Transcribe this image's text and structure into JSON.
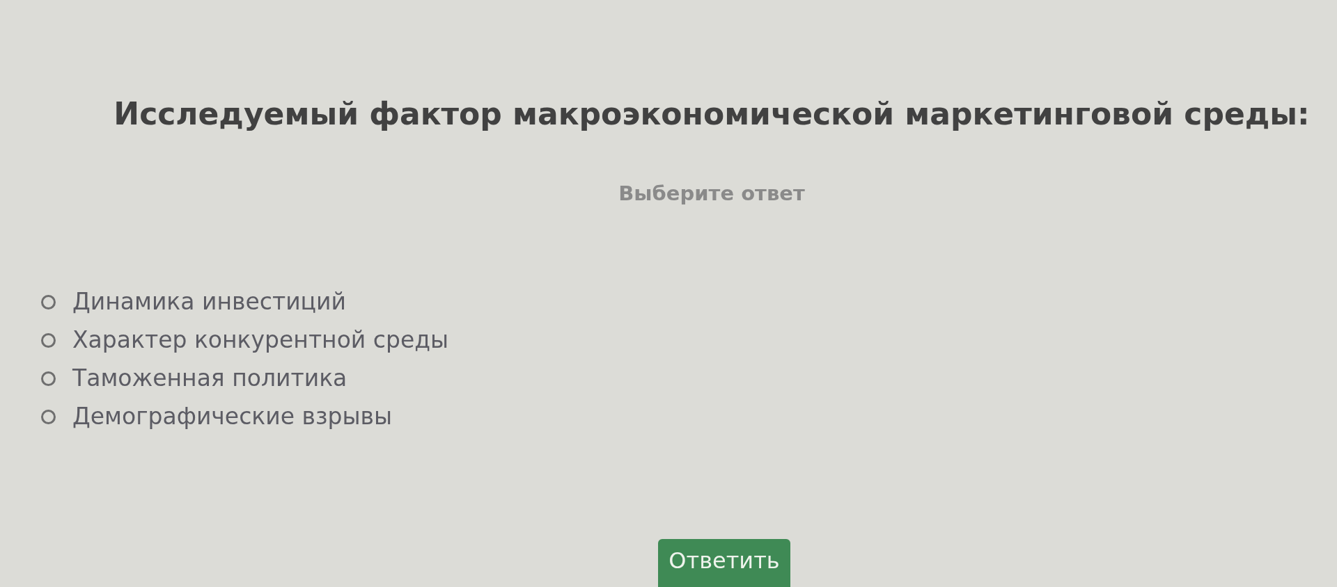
{
  "question": {
    "title": "Исследуемый фактор макроэкономической маркетинговой среды:",
    "hint": "Выберите ответ"
  },
  "options": [
    {
      "label": "Динамика инвестиций",
      "selected": false
    },
    {
      "label": "Характер конкурентной среды",
      "selected": false
    },
    {
      "label": "Таможенная политика",
      "selected": false
    },
    {
      "label": "Демографические взрывы",
      "selected": false
    }
  ],
  "submit_button": {
    "label": "Ответить"
  }
}
